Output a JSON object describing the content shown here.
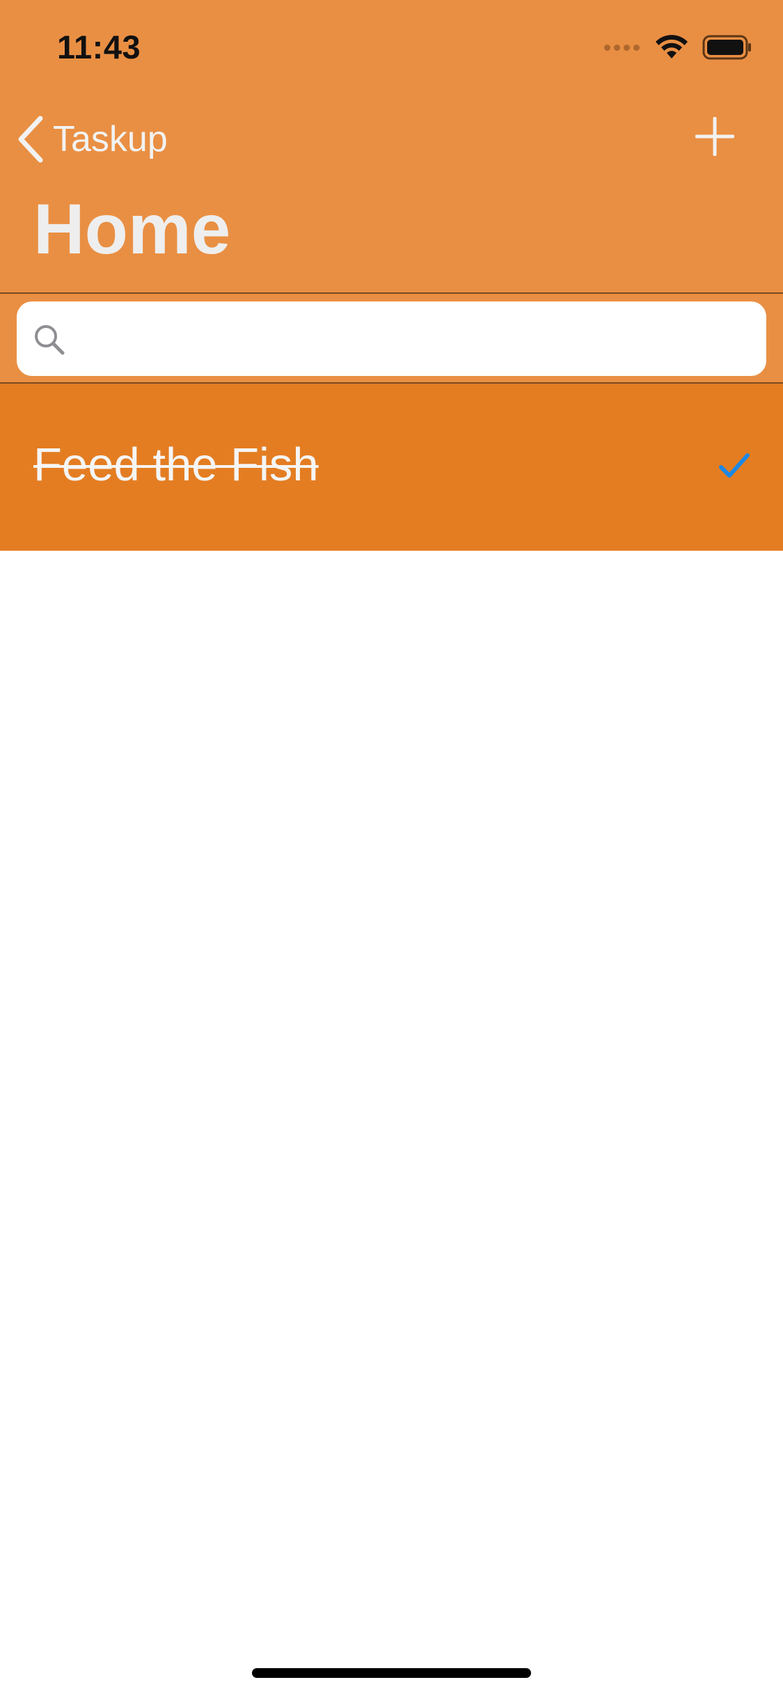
{
  "status_bar": {
    "time": "11:43"
  },
  "nav": {
    "back_label": "Taskup",
    "add_icon": "plus-icon",
    "title": "Home"
  },
  "search": {
    "placeholder": "",
    "value": ""
  },
  "tasks": [
    {
      "title": "Feed the Fish",
      "done": true
    }
  ],
  "colors": {
    "header": "#E98F43",
    "row": "#E47D22",
    "check": "#1E88E5",
    "text_light": "#F2F2F2"
  }
}
